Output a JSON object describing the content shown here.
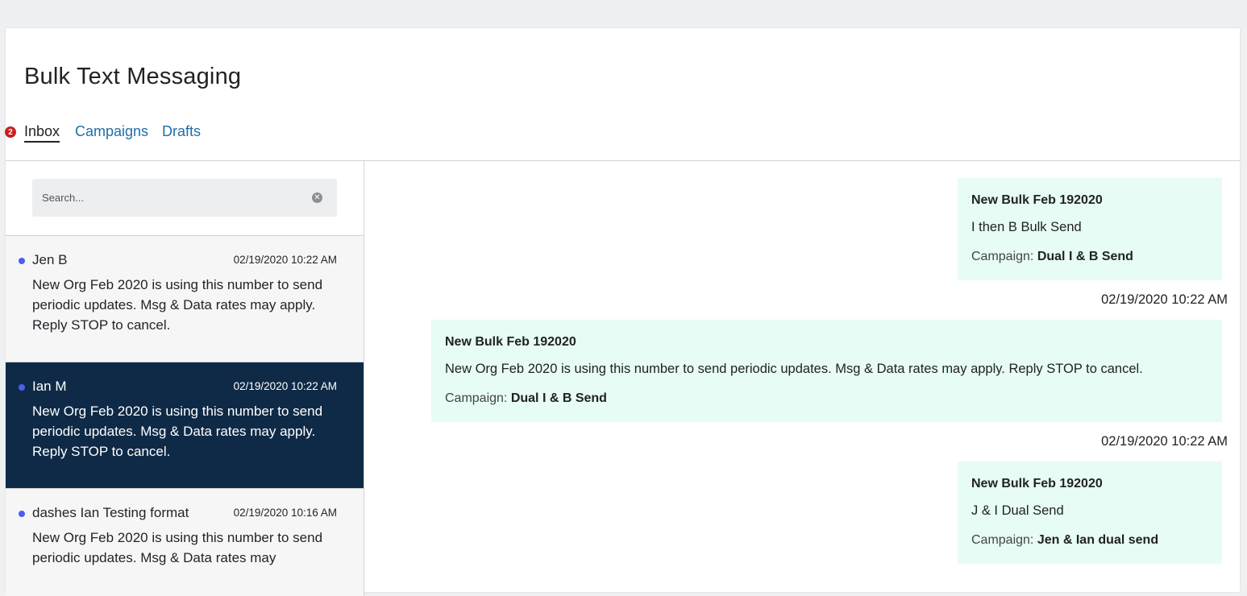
{
  "page": {
    "title": "Bulk Text Messaging"
  },
  "tabs": [
    {
      "label": "Inbox",
      "badge": "2",
      "active": true
    },
    {
      "label": "Campaigns"
    },
    {
      "label": "Drafts"
    }
  ],
  "search": {
    "placeholder": "Search...",
    "value": ""
  },
  "conversations": [
    {
      "name": "Jen B",
      "time": "02/19/2020 10:22 AM",
      "preview": "New Org Feb 2020 is using this number to send periodic updates. Msg & Data rates may apply. Reply STOP to cancel.",
      "unread": true,
      "selected": false
    },
    {
      "name": "Ian M",
      "time": "02/19/2020 10:22 AM",
      "preview": "New Org Feb 2020 is using this number to send periodic updates. Msg & Data rates may apply. Reply STOP to cancel.",
      "unread": true,
      "selected": true
    },
    {
      "name": "dashes Ian Testing format",
      "time": "02/19/2020 10:16 AM",
      "preview": "New Org Feb 2020 is using this number to send periodic updates. Msg & Data rates may",
      "unread": true,
      "selected": false
    }
  ],
  "messages": [
    {
      "title": "New Bulk Feb 192020",
      "text": "I then B Bulk Send",
      "campaign_label": "Campaign:",
      "campaign": "Dual I & B Send"
    },
    {
      "timestamp": "02/19/2020 10:22 AM",
      "title": "New Bulk Feb 192020",
      "text": "New Org Feb 2020 is using this number to send periodic updates. Msg & Data rates may apply. Reply STOP to cancel.",
      "campaign_label": "Campaign:",
      "campaign": "Dual I & B Send"
    },
    {
      "timestamp": "02/19/2020 10:22 AM",
      "title": "New Bulk Feb 192020",
      "text": "J & I Dual Send",
      "campaign_label": "Campaign:",
      "campaign": "Jen & Ian dual send"
    }
  ],
  "colors": {
    "accent": "#1f6fa8",
    "badge": "#cc1f1f",
    "selected_row": "#0f2a47",
    "bubble": "#e6fcf4",
    "unread_dot": "#4a5ef0"
  }
}
